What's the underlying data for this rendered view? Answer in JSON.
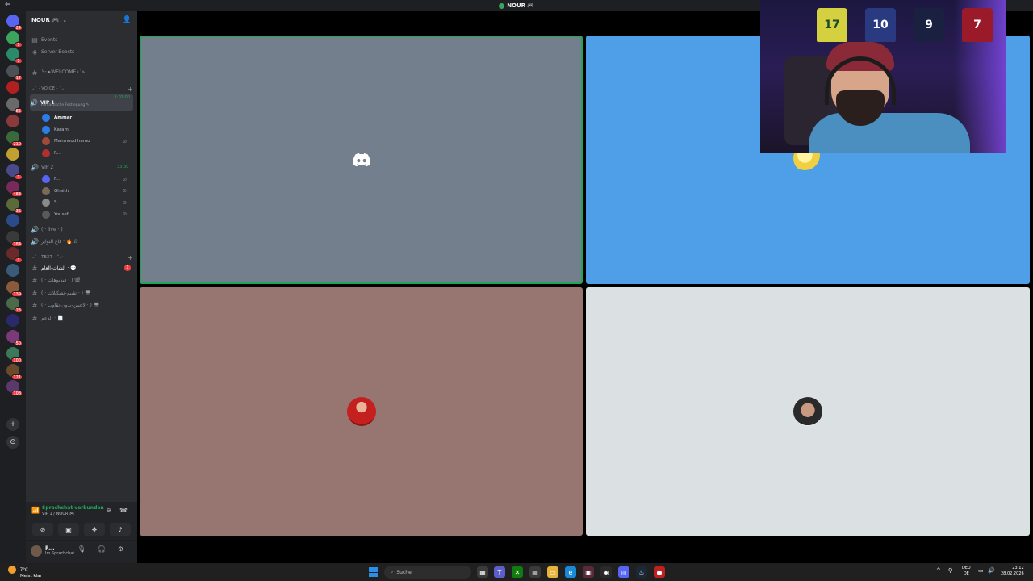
{
  "window": {
    "title": "NOUR",
    "title_suffix": "🎮"
  },
  "server": {
    "name": "NOUR",
    "name_suffix": "🎮"
  },
  "sidebar": {
    "top_items": [
      {
        "label": "Events",
        "icon": "calendar-icon"
      },
      {
        "label": "Server-Boosts",
        "icon": "boost-icon"
      }
    ],
    "welcome_channel": "╰┈➤WELCOME⋆˙⟡",
    "voice_category": "‧₊˚ ⋅ VOICE ⋅ ˚₊‧",
    "voice_channels": [
      {
        "name": "VIP 1",
        "prefix": "·",
        "timer": "1:07:00",
        "status": "Fantastische Festlegung ✎",
        "active": true,
        "members": [
          {
            "name": "Ammar",
            "color": "#2b7de9",
            "bold": true,
            "muted": false
          },
          {
            "name": "Karam",
            "color": "#2b7de9",
            "bold": false,
            "muted": false
          },
          {
            "name": "Mahmood hamo",
            "color": "#a04a3a",
            "bold": false,
            "muted": true
          },
          {
            "name": "R...",
            "color": "#b03030",
            "bold": false,
            "muted": false
          }
        ]
      },
      {
        "name": "VIP 2",
        "prefix": "·",
        "timer": "33:30",
        "status": "",
        "active": false,
        "members": [
          {
            "name": "F...",
            "color": "#5865f2",
            "bold": false,
            "muted": true
          },
          {
            "name": "Ghaith",
            "color": "#7a6a5a",
            "bold": false,
            "muted": true
          },
          {
            "name": "S...",
            "color": "#8a8a8a",
            "bold": false,
            "muted": true
          },
          {
            "name": "Yousef",
            "color": "#5a5a5a",
            "bold": false,
            "muted": true
          }
        ]
      }
    ],
    "extra_voice": [
      {
        "name": "( · live · )"
      },
      {
        "name": "قاع النوابر · 🔥 ⅅ"
      }
    ],
    "text_category": "‧₊˚ ⋅ TEXT ⋅ ˚₊‧",
    "text_channels": [
      {
        "name": "الشات-العام · 💬",
        "badge": "1",
        "bold": true
      },
      {
        "name": "( · فيديوهات · ) 🎬",
        "badge": "",
        "bold": false
      },
      {
        "name": "( · تقييم-تشكيلات · ) 🖥",
        "badge": "",
        "bold": false
      },
      {
        "name": "( · لاعبين-بدون-نقاوب · ) 🖥",
        "badge": "",
        "bold": false
      },
      {
        "name": "الدعم · 📄",
        "badge": "",
        "bold": false
      }
    ]
  },
  "voice_panel": {
    "status": "Sprachchat verbunden",
    "channel": "VIP 1 / NOUR 🎮"
  },
  "user_panel": {
    "name": "R...",
    "status": "Im Sprachchat"
  },
  "server_rail": {
    "badges": [
      "24",
      "1",
      "1",
      "17",
      "",
      "86",
      "",
      "210",
      "",
      "1",
      "483",
      "36",
      "",
      "284",
      "1",
      "",
      "139",
      "23",
      "",
      "50",
      "100",
      "121",
      "108"
    ]
  },
  "stage": {
    "tiles": [
      {
        "bg": "#747f8d",
        "kind": "discord-logo",
        "speaking": true
      },
      {
        "bg": "#4f9ee8",
        "kind": "avatar-cartoon",
        "speaking": false
      },
      {
        "bg": "#977672",
        "kind": "avatar-red",
        "speaking": false
      },
      {
        "bg": "#dbe1e2",
        "kind": "avatar-person",
        "speaking": false
      }
    ],
    "webcam_jerseys": [
      "17",
      "10",
      "9",
      "7"
    ]
  },
  "taskbar": {
    "weather_temp": "7°C",
    "weather_text": "Meist klar",
    "search_placeholder": "Suche",
    "lang_top": "DEU",
    "lang_bottom": "DE",
    "time": "23:12",
    "date": "28.02.2026"
  }
}
